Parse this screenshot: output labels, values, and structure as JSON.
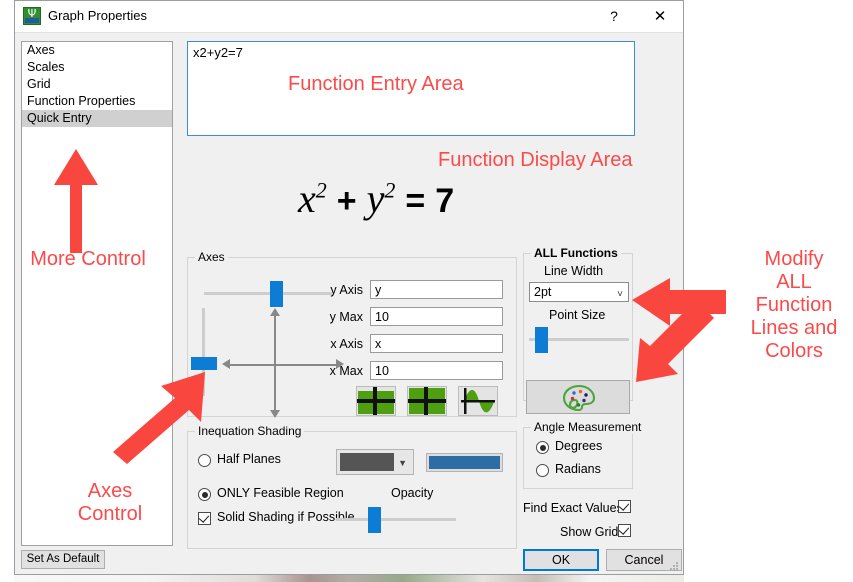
{
  "window": {
    "title": "Graph Properties",
    "icon": "app-icon",
    "help_label": "?",
    "close_label": "✕"
  },
  "sidebar": {
    "items": [
      {
        "label": "Axes",
        "selected": false
      },
      {
        "label": "Scales",
        "selected": false
      },
      {
        "label": "Grid",
        "selected": false
      },
      {
        "label": "Function Properties",
        "selected": false
      },
      {
        "label": "Quick Entry",
        "selected": true
      }
    ],
    "set_as_default_label": "Set As Default"
  },
  "function_entry": {
    "value": "x2+y2=7",
    "annotation": "Function Entry Area"
  },
  "function_display": {
    "annotation": "Function Display Area",
    "base_x": "x",
    "exp_x": "2",
    "plus": "+",
    "base_y": "y",
    "exp_y": "2",
    "equals": "=",
    "result": "7"
  },
  "axes_group": {
    "legend": "Axes",
    "fields": [
      {
        "label": "y Axis",
        "value": "y"
      },
      {
        "label": "y Max",
        "value": "10"
      },
      {
        "label": "x Axis",
        "value": "x"
      },
      {
        "label": "x Max",
        "value": "10"
      }
    ],
    "icon_buttons": [
      {
        "name": "axes-style-offset-icon"
      },
      {
        "name": "axes-style-centered-icon"
      },
      {
        "name": "axes-style-wave-icon"
      }
    ]
  },
  "inequation_group": {
    "legend": "Inequation Shading",
    "half_planes_label": "Half Planes",
    "half_planes_selected": false,
    "only_feasible_label": "ONLY Feasible Region",
    "only_feasible_selected": true,
    "solid_shading_label": "Solid Shading if Possible",
    "solid_shading_checked": true,
    "opacity_label": "Opacity",
    "shade_color": "#555555",
    "accent_color": "#2e6da4"
  },
  "all_functions_group": {
    "legend": "ALL Functions",
    "line_width_label": "Line Width",
    "line_width_value": "2pt",
    "point_size_label": "Point Size",
    "palette_icon": "color-palette-icon"
  },
  "angle_group": {
    "legend": "Angle Measurement",
    "degrees_label": "Degrees",
    "degrees_selected": true,
    "radians_label": "Radians",
    "radians_selected": false
  },
  "options": {
    "find_exact_values_label": "Find Exact Values",
    "find_exact_values_checked": true,
    "show_grid_label": "Show Grid",
    "show_grid_checked": true
  },
  "buttons": {
    "ok_label": "OK",
    "cancel_label": "Cancel"
  },
  "annotations": {
    "more_control": "More Control",
    "axes_control": "Axes\nControl",
    "modify_all": "Modify\nALL\nFunction\nLines and\nColors",
    "color": "#fc4a4a"
  }
}
